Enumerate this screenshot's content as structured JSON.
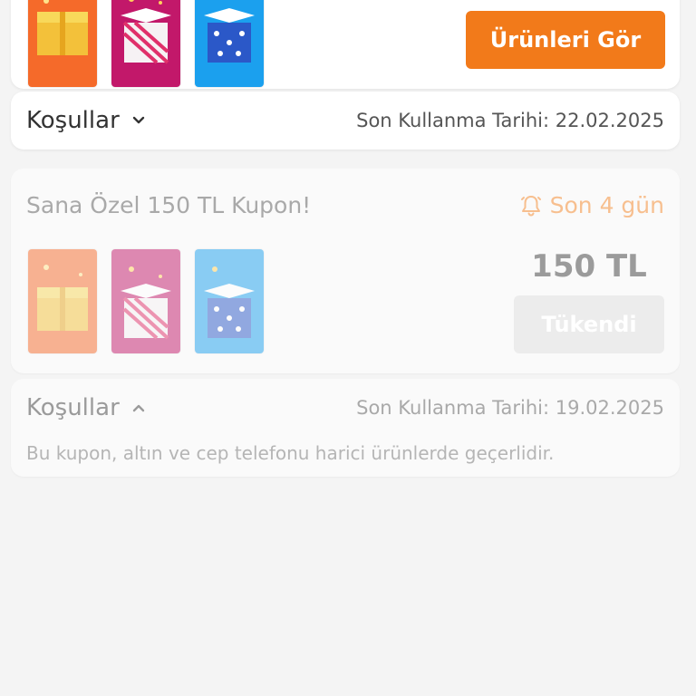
{
  "colors": {
    "brand_orange": "#f27a1a",
    "bg": "#f4f4f4",
    "faded_orange": "#f7bf8f",
    "disabled_button": "#ececec"
  },
  "coupon_1": {
    "button_label": "Ürünleri Gör",
    "thumbnails": [
      "gold-gift-box-icon",
      "pink-gift-box-icon",
      "blue-gift-box-icon"
    ],
    "conditions": {
      "label": "Koşullar",
      "toggle_icon": "chevron-down-icon",
      "expiry": "Son Kullanma Tarihi: 22.02.2025"
    }
  },
  "coupon_2": {
    "title": "Sana Özel 150 TL Kupon!",
    "days_left_icon": "bell-icon",
    "days_left": "Son 4 gün",
    "amount": "150 TL",
    "button_label": "Tükendi",
    "thumbnails": [
      "gold-gift-box-icon",
      "pink-gift-box-icon",
      "blue-gift-box-icon"
    ],
    "conditions": {
      "label": "Koşullar",
      "toggle_icon": "chevron-up-icon",
      "expiry": "Son Kullanma Tarihi: 19.02.2025",
      "description": "Bu kupon, altın ve cep telefonu harici ürünlerde geçerlidir."
    }
  }
}
